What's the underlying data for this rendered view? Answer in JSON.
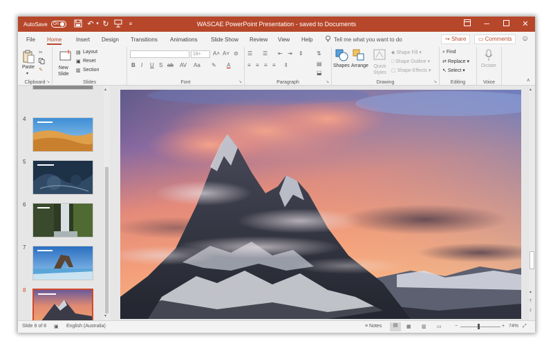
{
  "titlebar": {
    "autosave_label": "AutoSave",
    "autosave_state": "On",
    "title": "WASCAE PowerPoint Presentation  - saved to Documents",
    "qat_icons": [
      "save-icon",
      "undo-icon",
      "redo-icon",
      "present-icon",
      "customize-icon"
    ],
    "window_buttons": [
      "ribbon-display-icon",
      "minimize-icon",
      "restore-icon",
      "close-icon"
    ]
  },
  "tabs": {
    "items": [
      "File",
      "Home",
      "Insert",
      "Design",
      "Transitions",
      "Animations",
      "Slide Show",
      "Review",
      "View",
      "Help"
    ],
    "active": "Home",
    "tell_me": "Tell me what you want to do",
    "share": "Share",
    "comments": "Comments"
  },
  "ribbon": {
    "clipboard": {
      "label": "Clipboard",
      "paste": "Paste"
    },
    "slides": {
      "label": "Slides",
      "new_slide": "New\nSlide",
      "layout": "Layout",
      "reset": "Reset",
      "section": "Section"
    },
    "font": {
      "label": "Font",
      "font_name": "",
      "font_size": "18+",
      "buttons": [
        "B",
        "I",
        "U",
        "S",
        "ab",
        "AV",
        "Aa",
        "A"
      ]
    },
    "paragraph": {
      "label": "Paragraph"
    },
    "drawing": {
      "label": "Drawing",
      "shapes": "Shapes",
      "arrange": "Arrange",
      "quick_styles": "Quick\nStyles",
      "shape_fill": "Shape Fill",
      "shape_outline": "Shape Outline",
      "shape_effects": "Shape Effects"
    },
    "editing": {
      "label": "Editing",
      "find": "Find",
      "replace": "Replace",
      "select": "Select"
    },
    "voice": {
      "label": "Voice",
      "dictate": "Dictate"
    }
  },
  "thumbnails": {
    "items": [
      {
        "number": "4",
        "scene": "desert",
        "selected": false
      },
      {
        "number": "5",
        "scene": "aerial-rocks",
        "selected": false
      },
      {
        "number": "6",
        "scene": "waterfall",
        "selected": false
      },
      {
        "number": "7",
        "scene": "rock-arch",
        "selected": false
      },
      {
        "number": "8",
        "scene": "mountain-sunset",
        "selected": true
      }
    ]
  },
  "slide": {
    "scene": "mountain-sunset"
  },
  "statusbar": {
    "slide_info": "Slide 8 of 8",
    "language": "English (Australia)",
    "notes": "Notes",
    "zoom": "74%"
  },
  "colors": {
    "accent": "#b7472a",
    "selection": "#d04a2a"
  }
}
